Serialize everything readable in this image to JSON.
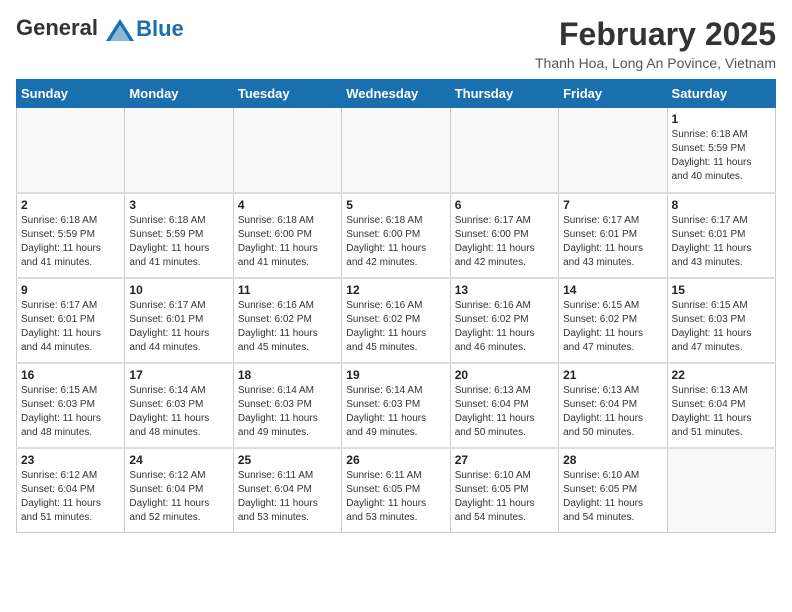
{
  "logo": {
    "line1": "General",
    "line2": "Blue"
  },
  "title": "February 2025",
  "subtitle": "Thanh Hoa, Long An Povince, Vietnam",
  "days_of_week": [
    "Sunday",
    "Monday",
    "Tuesday",
    "Wednesday",
    "Thursday",
    "Friday",
    "Saturday"
  ],
  "weeks": [
    [
      {
        "day": "",
        "info": ""
      },
      {
        "day": "",
        "info": ""
      },
      {
        "day": "",
        "info": ""
      },
      {
        "day": "",
        "info": ""
      },
      {
        "day": "",
        "info": ""
      },
      {
        "day": "",
        "info": ""
      },
      {
        "day": "1",
        "info": "Sunrise: 6:18 AM\nSunset: 5:59 PM\nDaylight: 11 hours\nand 40 minutes."
      }
    ],
    [
      {
        "day": "2",
        "info": "Sunrise: 6:18 AM\nSunset: 5:59 PM\nDaylight: 11 hours\nand 41 minutes."
      },
      {
        "day": "3",
        "info": "Sunrise: 6:18 AM\nSunset: 5:59 PM\nDaylight: 11 hours\nand 41 minutes."
      },
      {
        "day": "4",
        "info": "Sunrise: 6:18 AM\nSunset: 6:00 PM\nDaylight: 11 hours\nand 41 minutes."
      },
      {
        "day": "5",
        "info": "Sunrise: 6:18 AM\nSunset: 6:00 PM\nDaylight: 11 hours\nand 42 minutes."
      },
      {
        "day": "6",
        "info": "Sunrise: 6:17 AM\nSunset: 6:00 PM\nDaylight: 11 hours\nand 42 minutes."
      },
      {
        "day": "7",
        "info": "Sunrise: 6:17 AM\nSunset: 6:01 PM\nDaylight: 11 hours\nand 43 minutes."
      },
      {
        "day": "8",
        "info": "Sunrise: 6:17 AM\nSunset: 6:01 PM\nDaylight: 11 hours\nand 43 minutes."
      }
    ],
    [
      {
        "day": "9",
        "info": "Sunrise: 6:17 AM\nSunset: 6:01 PM\nDaylight: 11 hours\nand 44 minutes."
      },
      {
        "day": "10",
        "info": "Sunrise: 6:17 AM\nSunset: 6:01 PM\nDaylight: 11 hours\nand 44 minutes."
      },
      {
        "day": "11",
        "info": "Sunrise: 6:16 AM\nSunset: 6:02 PM\nDaylight: 11 hours\nand 45 minutes."
      },
      {
        "day": "12",
        "info": "Sunrise: 6:16 AM\nSunset: 6:02 PM\nDaylight: 11 hours\nand 45 minutes."
      },
      {
        "day": "13",
        "info": "Sunrise: 6:16 AM\nSunset: 6:02 PM\nDaylight: 11 hours\nand 46 minutes."
      },
      {
        "day": "14",
        "info": "Sunrise: 6:15 AM\nSunset: 6:02 PM\nDaylight: 11 hours\nand 47 minutes."
      },
      {
        "day": "15",
        "info": "Sunrise: 6:15 AM\nSunset: 6:03 PM\nDaylight: 11 hours\nand 47 minutes."
      }
    ],
    [
      {
        "day": "16",
        "info": "Sunrise: 6:15 AM\nSunset: 6:03 PM\nDaylight: 11 hours\nand 48 minutes."
      },
      {
        "day": "17",
        "info": "Sunrise: 6:14 AM\nSunset: 6:03 PM\nDaylight: 11 hours\nand 48 minutes."
      },
      {
        "day": "18",
        "info": "Sunrise: 6:14 AM\nSunset: 6:03 PM\nDaylight: 11 hours\nand 49 minutes."
      },
      {
        "day": "19",
        "info": "Sunrise: 6:14 AM\nSunset: 6:03 PM\nDaylight: 11 hours\nand 49 minutes."
      },
      {
        "day": "20",
        "info": "Sunrise: 6:13 AM\nSunset: 6:04 PM\nDaylight: 11 hours\nand 50 minutes."
      },
      {
        "day": "21",
        "info": "Sunrise: 6:13 AM\nSunset: 6:04 PM\nDaylight: 11 hours\nand 50 minutes."
      },
      {
        "day": "22",
        "info": "Sunrise: 6:13 AM\nSunset: 6:04 PM\nDaylight: 11 hours\nand 51 minutes."
      }
    ],
    [
      {
        "day": "23",
        "info": "Sunrise: 6:12 AM\nSunset: 6:04 PM\nDaylight: 11 hours\nand 51 minutes."
      },
      {
        "day": "24",
        "info": "Sunrise: 6:12 AM\nSunset: 6:04 PM\nDaylight: 11 hours\nand 52 minutes."
      },
      {
        "day": "25",
        "info": "Sunrise: 6:11 AM\nSunset: 6:04 PM\nDaylight: 11 hours\nand 53 minutes."
      },
      {
        "day": "26",
        "info": "Sunrise: 6:11 AM\nSunset: 6:05 PM\nDaylight: 11 hours\nand 53 minutes."
      },
      {
        "day": "27",
        "info": "Sunrise: 6:10 AM\nSunset: 6:05 PM\nDaylight: 11 hours\nand 54 minutes."
      },
      {
        "day": "28",
        "info": "Sunrise: 6:10 AM\nSunset: 6:05 PM\nDaylight: 11 hours\nand 54 minutes."
      },
      {
        "day": "",
        "info": ""
      }
    ]
  ]
}
